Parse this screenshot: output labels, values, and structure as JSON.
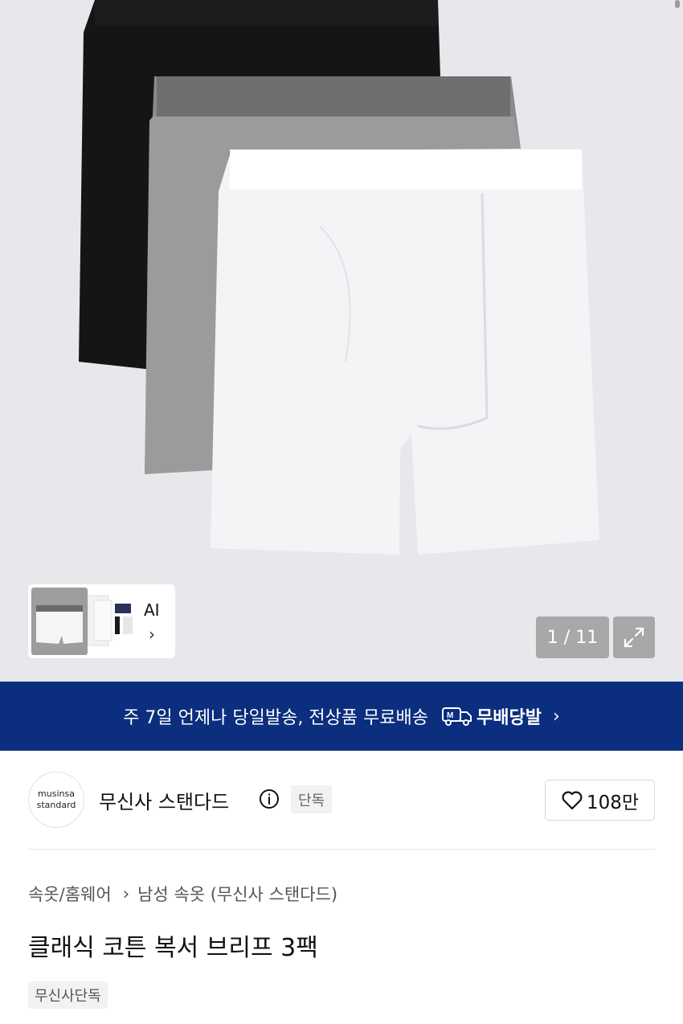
{
  "gallery": {
    "image_alt": "product-photo",
    "counter": "1 / 11",
    "thumbnail_ai_label": "AI",
    "thumbnail_chevron": "›"
  },
  "banner": {
    "text": "주 7일 언제나 당일발송, 전상품 무료배송",
    "badge_label": "무배당발",
    "chevron": "›",
    "background_color": "#0b2e7e"
  },
  "brand": {
    "logo_line1": "musinsa",
    "logo_line2": "standard",
    "name": "무신사 스탠다드",
    "exclusive_tag": "단독",
    "like_count": "108만"
  },
  "breadcrumb": {
    "level1": "속옷/홈웨어",
    "separator": "›",
    "level2": "남성 속옷 (무신사 스탠다드)"
  },
  "product": {
    "title": "클래식 코튼 복서 브리프 3팩",
    "tag": "무신사단독"
  },
  "icons": [
    "info-icon",
    "heart-icon",
    "expand-icon",
    "truck-icon",
    "chevron-right-icon"
  ]
}
